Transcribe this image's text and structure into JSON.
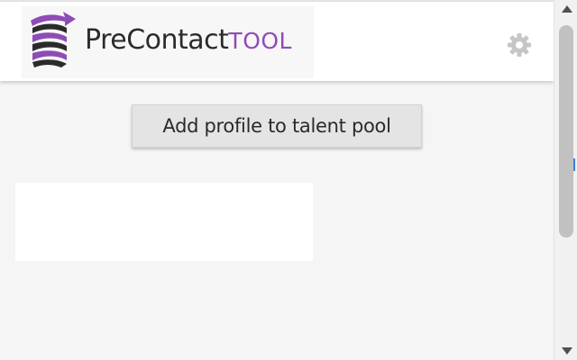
{
  "header": {
    "logo": {
      "part1": "PreContact",
      "part2": "TOOL",
      "icon": "spiral-arrow-logo-icon",
      "brand_purple": "#8e4cb6",
      "brand_dark": "#2b2b2b"
    },
    "settings_icon": "gear-icon"
  },
  "main": {
    "add_button_label": "Add profile to talent pool"
  },
  "scrollbar": {
    "up_icon": "scroll-up-arrow-icon",
    "down_icon": "scroll-down-arrow-icon",
    "thumb_fraction_visible": 0.6
  }
}
